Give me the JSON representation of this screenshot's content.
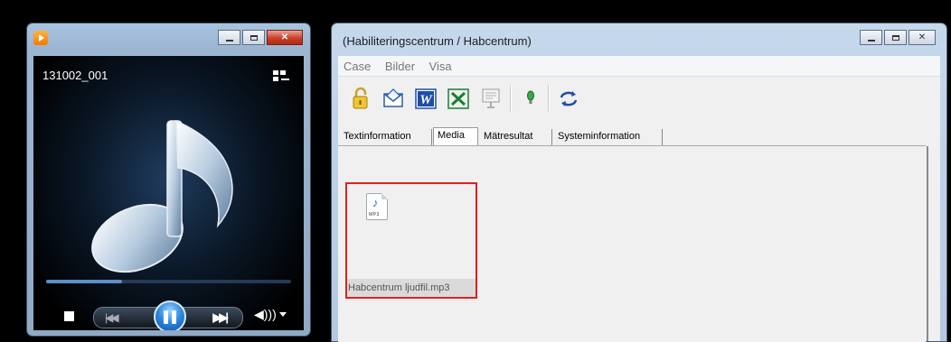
{
  "player": {
    "track_title": "131002_001",
    "progress_fraction": 0.31,
    "icons": {
      "app": "media-player-app-icon",
      "layout": "switch-to-library-icon",
      "stop": "stop-icon",
      "previous": "previous-track-icon",
      "pause": "pause-icon",
      "next": "next-track-icon",
      "volume": "volume-icon"
    }
  },
  "hab": {
    "title": "(Habiliteringscentrum / Habcentrum)",
    "menu": [
      "Case",
      "Bilder",
      "Visa"
    ],
    "toolbar_icons": [
      "lock-icon",
      "email-icon",
      "word-icon",
      "excel-icon",
      "presentation-icon",
      "lightbulb-icon",
      "refresh-icon"
    ],
    "tabs": [
      "Textinformation",
      "Media",
      "Mätresultat",
      "Systeminformation"
    ],
    "active_tab": "Media",
    "media_file": {
      "name": "Habcentrum ljudfil.mp3",
      "icon_ext": "MP3"
    }
  },
  "colors": {
    "highlight_border": "#e0201c",
    "word_blue": "#1f4ea8",
    "excel_green": "#1f7a3a"
  }
}
